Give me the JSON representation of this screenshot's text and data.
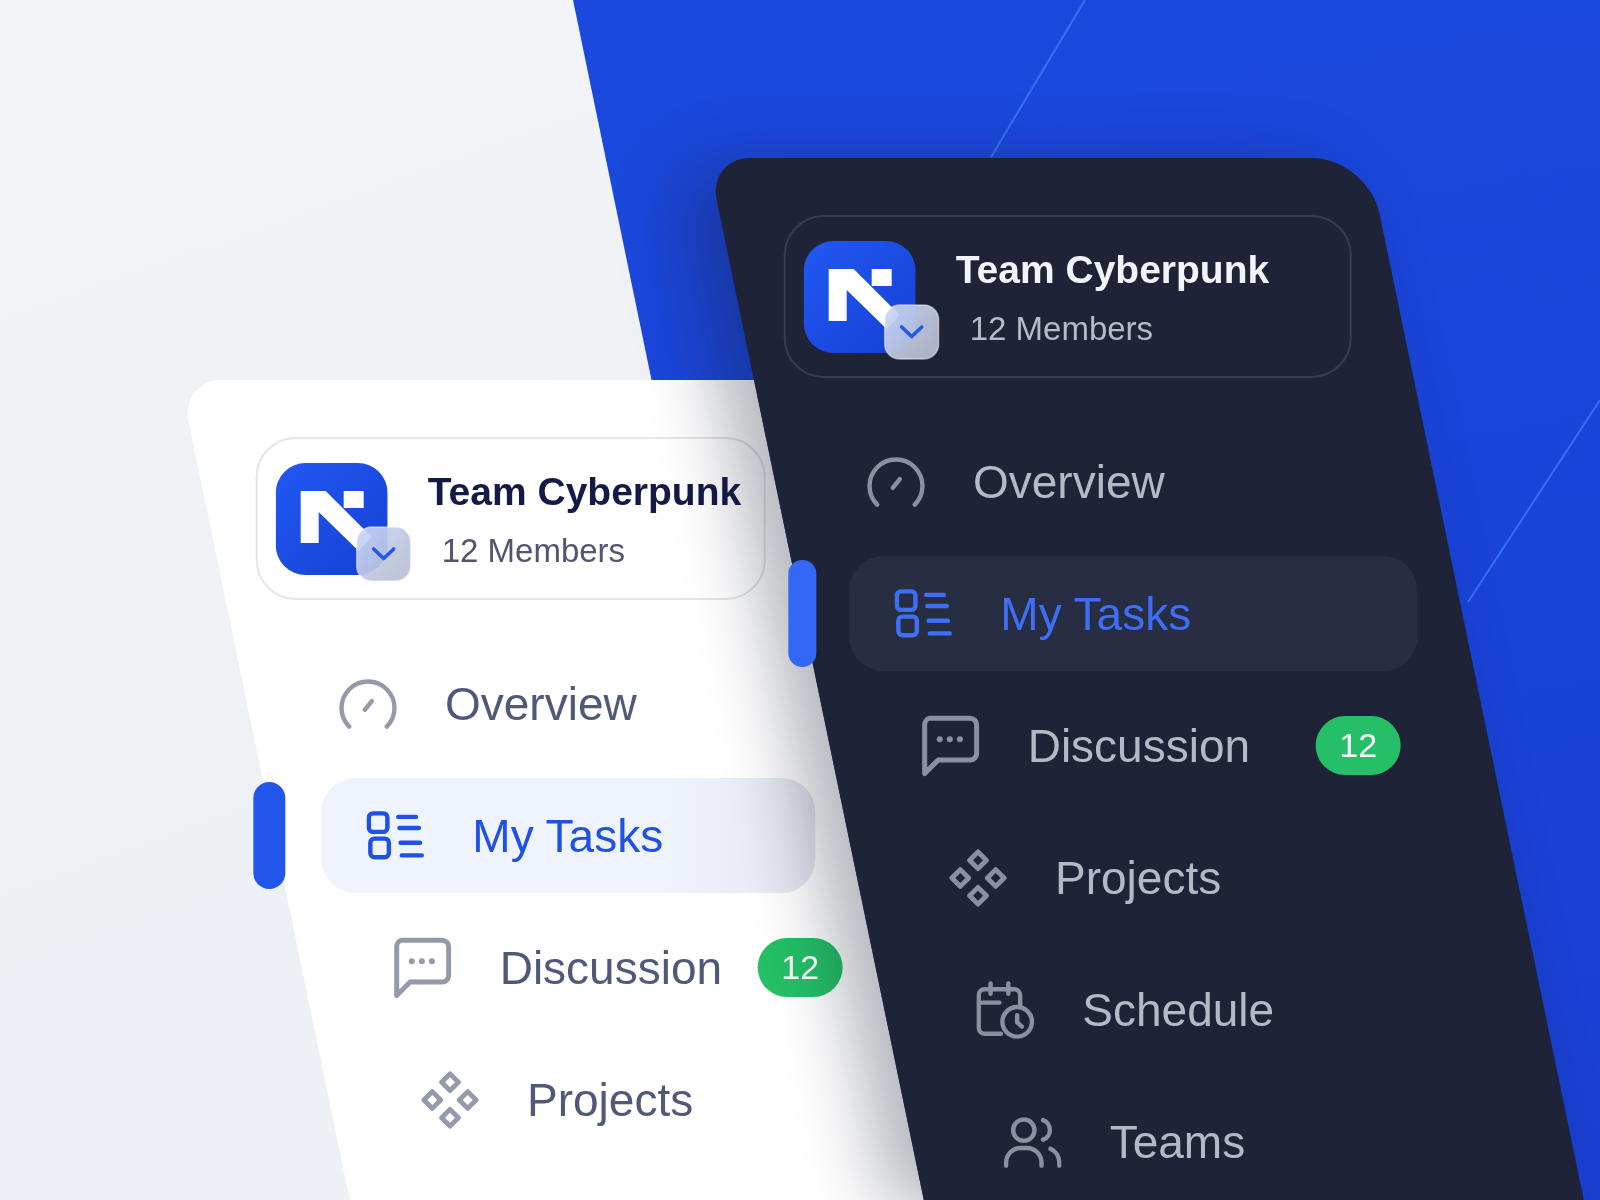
{
  "panels": [
    {
      "kind": "light",
      "team": {
        "name": "Team Cyberpunk",
        "members": "12 Members"
      },
      "nav": [
        {
          "label": "Overview",
          "selected": false
        },
        {
          "label": "My Tasks",
          "selected": true
        },
        {
          "label": "Discussion",
          "selected": false,
          "badge": "12"
        },
        {
          "label": "Projects",
          "selected": false
        }
      ]
    },
    {
      "kind": "dark",
      "team": {
        "name": "Team Cyberpunk",
        "members": "12 Members"
      },
      "nav": [
        {
          "label": "Overview",
          "selected": false
        },
        {
          "label": "My Tasks",
          "selected": true
        },
        {
          "label": "Discussion",
          "selected": false,
          "badge": "12"
        },
        {
          "label": "Projects",
          "selected": false
        },
        {
          "label": "Schedule",
          "selected": false
        },
        {
          "label": "Teams",
          "selected": false
        }
      ]
    }
  ]
}
